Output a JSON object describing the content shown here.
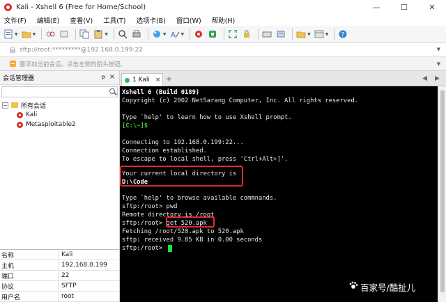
{
  "window": {
    "title": "Kali - Xshell 6 (Free for Home/School)",
    "minimize": "—",
    "maximize": "☐",
    "close": "✕"
  },
  "menu": [
    "文件(F)",
    "编辑(E)",
    "查看(V)",
    "工具(T)",
    "选项卡(B)",
    "窗口(W)",
    "帮助(H)"
  ],
  "address": {
    "text": "sftp://root:*********@192.168.0.199:22"
  },
  "hint": {
    "text": "要添加当前会话，点击左侧的箭头按钮。"
  },
  "sidebar": {
    "title": "会话管理器",
    "pin": "ᵽ",
    "close": "×",
    "tree": {
      "root_label": "所有会话",
      "expander": "−",
      "sessions": [
        "Kali",
        "Metasploitable2"
      ]
    },
    "properties": [
      {
        "key": "名称",
        "value": "Kali"
      },
      {
        "key": "主机",
        "value": "192.168.0.199"
      },
      {
        "key": "端口",
        "value": "22"
      },
      {
        "key": "协议",
        "value": "SFTP"
      },
      {
        "key": "用户名",
        "value": "root"
      }
    ]
  },
  "tabs": {
    "active_label": "1 Kali",
    "close": "×",
    "add": "+",
    "prev": "◀",
    "next": "▶"
  },
  "terminal": {
    "lines": [
      "Xshell 6 (Build 0189)",
      "Copyright (c) 2002 NetSarang Computer, Inc. All rights reserved.",
      "",
      "Type `help' to learn how to use Xshell prompt.",
      "[C:\\~]$",
      "",
      "Connecting to 192.168.0.199:22...",
      "Connection established.",
      "To escape to local shell, press 'Ctrl+Alt+]'.",
      "",
      "Your current local directory is",
      "D:\\Code",
      "",
      "Type `help' to browse available commnands.",
      "sftp:/root> pwd",
      "Remote directory is /root",
      "sftp:/root> get 520.apk",
      "Fetching /root/520.apk to 520.apk",
      "sftp: received 9.85 KB in 0.00 seconds",
      "sftp:/root> "
    ]
  },
  "watermark": {
    "text": "百家号/酷扯儿"
  },
  "colors": {
    "terminal_bg": "#000000",
    "highlight_box": "#e4282f",
    "cursor": "#18e33a",
    "session_icon": "#d9312b"
  }
}
